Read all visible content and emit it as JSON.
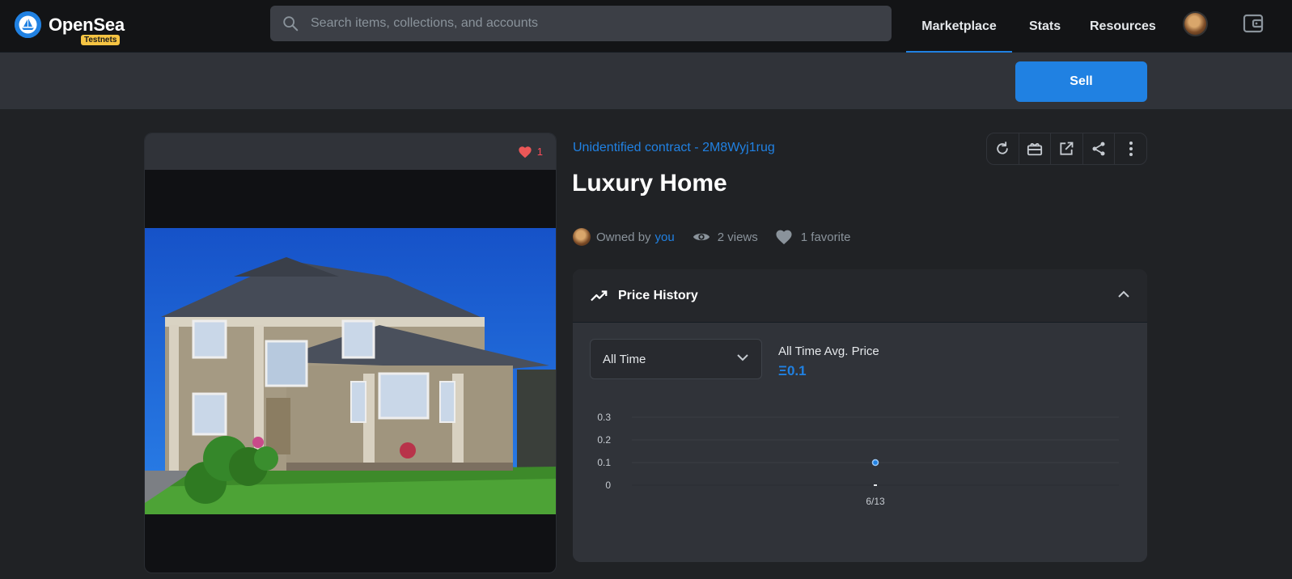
{
  "header": {
    "brand": "OpenSea",
    "badge": "Testnets",
    "search_placeholder": "Search items, collections, and accounts",
    "nav": [
      "Marketplace",
      "Stats",
      "Resources"
    ],
    "active_nav": "Marketplace"
  },
  "actions": {
    "sell_label": "Sell"
  },
  "item": {
    "favorites_count": "1",
    "contract": "Unidentified contract - 2M8Wyj1rug",
    "title": "Luxury Home",
    "owned_by_prefix": "Owned by",
    "owner": "you",
    "views": "2 views",
    "favorites": "1 favorite"
  },
  "price_history": {
    "title": "Price History",
    "range_selected": "All Time",
    "avg_label": "All Time Avg. Price",
    "avg_value": "Ξ0.1"
  },
  "chart_data": {
    "type": "scatter",
    "x": [
      "6/13"
    ],
    "y": [
      0.1
    ],
    "yticks": [
      0,
      0.1,
      0.2,
      0.3
    ],
    "ylim": [
      0,
      0.3
    ],
    "grid": true,
    "color": "#2081e2"
  },
  "colors": {
    "accent": "#2081e2",
    "favorite": "#eb5757",
    "badge": "#f6c443"
  }
}
